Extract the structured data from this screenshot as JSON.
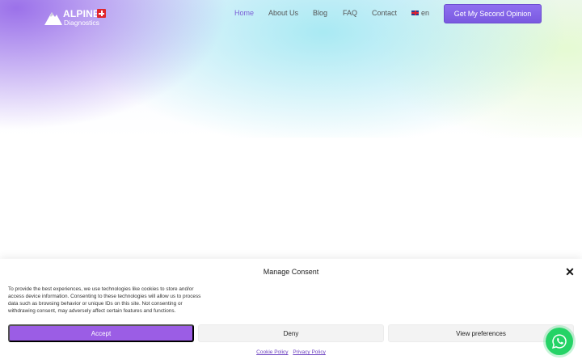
{
  "header": {
    "logo": {
      "word": "ALPINE",
      "sub": "Diagnostics"
    },
    "nav": [
      {
        "label": "Home"
      },
      {
        "label": "About Us"
      },
      {
        "label": "Blog"
      },
      {
        "label": "FAQ"
      },
      {
        "label": "Contact"
      }
    ],
    "language": "en",
    "cta_label": "Get My Second Opinion"
  },
  "consent": {
    "title": "Manage Consent",
    "close": "✕",
    "body": "To provide the best experiences, we use technologies like cookies to store and/or access device information. Consenting to these technologies will allow us to process data such as browsing behavior or unique IDs on this site. Not consenting or withdrawing consent, may adversely affect certain features and functions.",
    "accept_label": "Accept",
    "deny_label": "Deny",
    "prefs_label": "View preferences",
    "cookie_policy": "Cookie Policy",
    "privacy_policy": "Privacy Policy"
  },
  "colors": {
    "accent": "#9b5de5",
    "cta": "#7a5ae0",
    "whatsapp": "#25d366"
  },
  "icons": [
    "mountain-logo-icon",
    "swiss-flag-icon",
    "uk-flag-icon",
    "close-icon",
    "whatsapp-icon"
  ]
}
